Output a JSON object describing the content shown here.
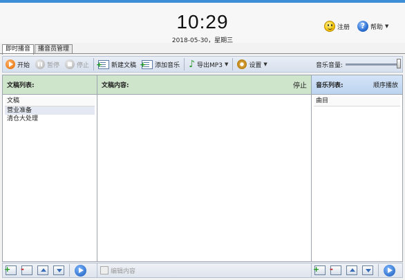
{
  "header": {
    "time": "10:29",
    "date": "2018-05-30，星期三",
    "register_label": "注册",
    "help_label": "帮助"
  },
  "tabs": [
    {
      "label": "即时播音",
      "active": true
    },
    {
      "label": "播音员管理",
      "active": false
    }
  ],
  "toolbar": {
    "start_label": "开始",
    "pause_label": "暂停",
    "stop_label": "停止",
    "new_doc_label": "新建文稿",
    "add_music_label": "添加音乐",
    "export_label": "导出MP3",
    "settings_label": "设置",
    "volume_label": "音乐音量:",
    "volume_level": 1.0
  },
  "left_panel": {
    "title": "文稿列表:",
    "column_header": "文稿",
    "items": [
      "营业准备",
      "清仓大处理"
    ]
  },
  "middle_panel": {
    "title": "文稿内容:",
    "status": "停止",
    "edit_label": "编辑内容"
  },
  "right_panel": {
    "title": "音乐列表:",
    "mode": "顺序播放",
    "column_header": "曲目"
  }
}
